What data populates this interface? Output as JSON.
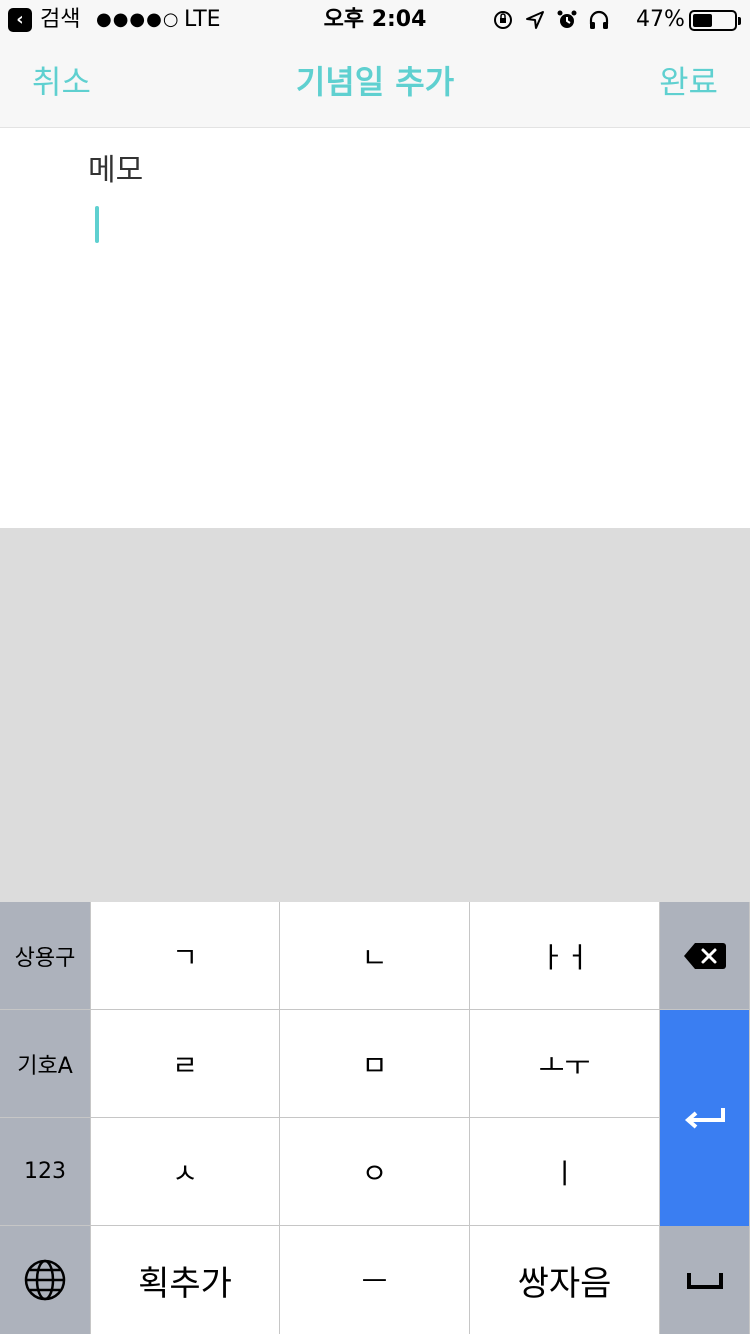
{
  "status_bar": {
    "back_app": "검색",
    "signal": "●●●●○",
    "network": "LTE",
    "time": "오후 2:04",
    "battery_percent": "47%",
    "battery_level": 0.47,
    "icons": [
      "orientation-lock-icon",
      "location-arrow-icon",
      "alarm-icon",
      "headphones-icon"
    ]
  },
  "nav": {
    "cancel": "취소",
    "title": "기념일 추가",
    "done": "완료",
    "accent_color": "#5fd0d0"
  },
  "content": {
    "memo_label": "메모"
  },
  "keyboard": {
    "rows": [
      [
        "상용구",
        "ㄱ",
        "ㄴ",
        "ㅏㅓ",
        "delete-icon"
      ],
      [
        "기호A",
        "ㄹ",
        "ㅁ",
        "ㅗㅜ",
        "return-icon"
      ],
      [
        "123",
        "ㅅ",
        "ㅇ",
        "ㅣ"
      ],
      [
        "globe-icon",
        "획추가",
        "ㅡ",
        "쌍자음",
        "space-icon"
      ]
    ],
    "return_color": "#3a7ef2"
  }
}
